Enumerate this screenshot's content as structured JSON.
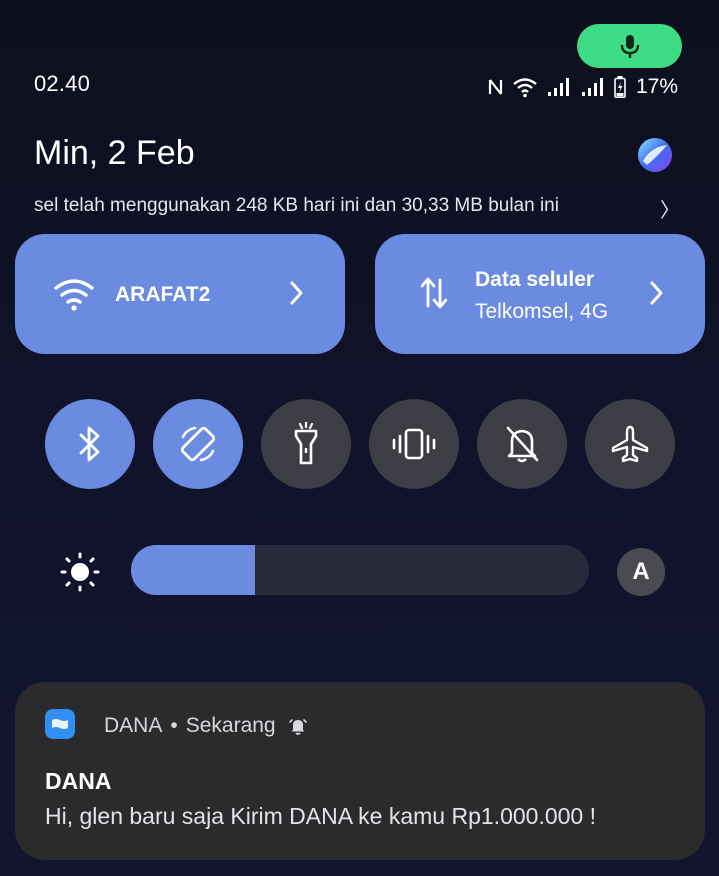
{
  "status_bar": {
    "time": "02.40",
    "battery": "17%",
    "icons": [
      "nfc-icon",
      "wifi-icon",
      "signal-icon",
      "signal-icon",
      "battery-charging-icon"
    ]
  },
  "mic_indicator": {
    "icon": "microphone-icon",
    "color": "#3ddc84"
  },
  "header": {
    "date": "Min, 2 Feb",
    "data_usage": "sel telah menggunakan 248 KB hari ini dan 30,33 MB bulan ini",
    "chevron": "〉"
  },
  "tiles": {
    "wifi": {
      "label": "ARAFAT2",
      "icon": "wifi-icon"
    },
    "mobile_data": {
      "label": "Data seluler",
      "sub": "Telkomsel, 4G",
      "icon": "data-transfer-icon"
    }
  },
  "toggles": [
    {
      "name": "bluetooth",
      "icon": "bluetooth-icon",
      "state": "on"
    },
    {
      "name": "auto-rotate",
      "icon": "rotate-icon",
      "state": "on"
    },
    {
      "name": "flashlight",
      "icon": "flashlight-icon",
      "state": "off"
    },
    {
      "name": "vibrate",
      "icon": "vibrate-icon",
      "state": "off"
    },
    {
      "name": "do-not-disturb",
      "icon": "bell-off-icon",
      "state": "off"
    },
    {
      "name": "airplane-mode",
      "icon": "airplane-icon",
      "state": "off"
    }
  ],
  "brightness": {
    "level": 0.27,
    "auto_label": "A"
  },
  "notification": {
    "app": "DANA",
    "separator": "•",
    "time": "Sekarang",
    "title": "DANA",
    "body": "Hi, glen baru saja Kirim DANA ke kamu Rp1.000.000 !"
  },
  "colors": {
    "accent": "#6b8be0",
    "toggle_off": "#3d3d45",
    "notification_bg": "#2b2b2e",
    "mic_green": "#3ddc84"
  }
}
